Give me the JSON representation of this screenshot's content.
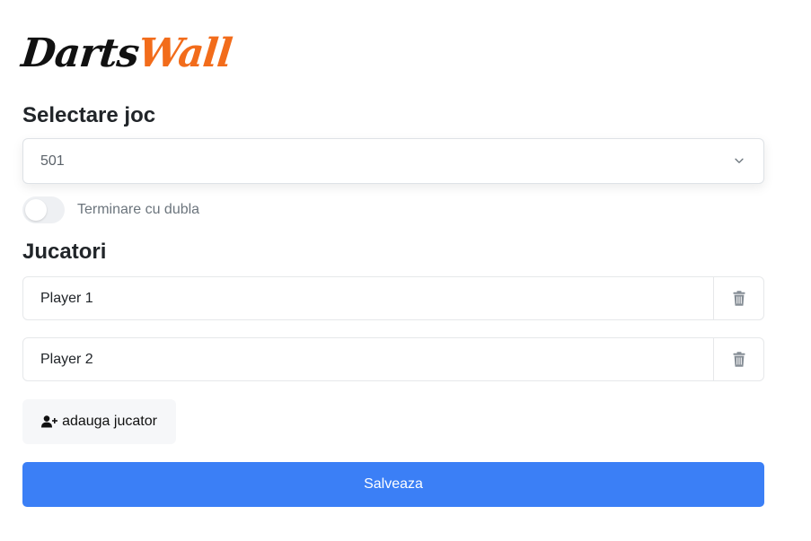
{
  "logo": {
    "part1": "Darts",
    "part2": "Wall",
    "accent_color": "#f26c1b"
  },
  "game_select": {
    "title": "Selectare joc",
    "selected_value": "501",
    "icon": "chevron-down-icon"
  },
  "double_out": {
    "label": "Terminare cu dubla",
    "enabled": false
  },
  "players": {
    "title": "Jucatori",
    "items": [
      {
        "name": "Player 1",
        "delete_icon": "trash-icon"
      },
      {
        "name": "Player 2",
        "delete_icon": "trash-icon"
      }
    ],
    "add_label": "adauga jucator",
    "add_icon": "user-plus-icon"
  },
  "save": {
    "label": "Salveaza",
    "color": "#3b7ff6"
  }
}
